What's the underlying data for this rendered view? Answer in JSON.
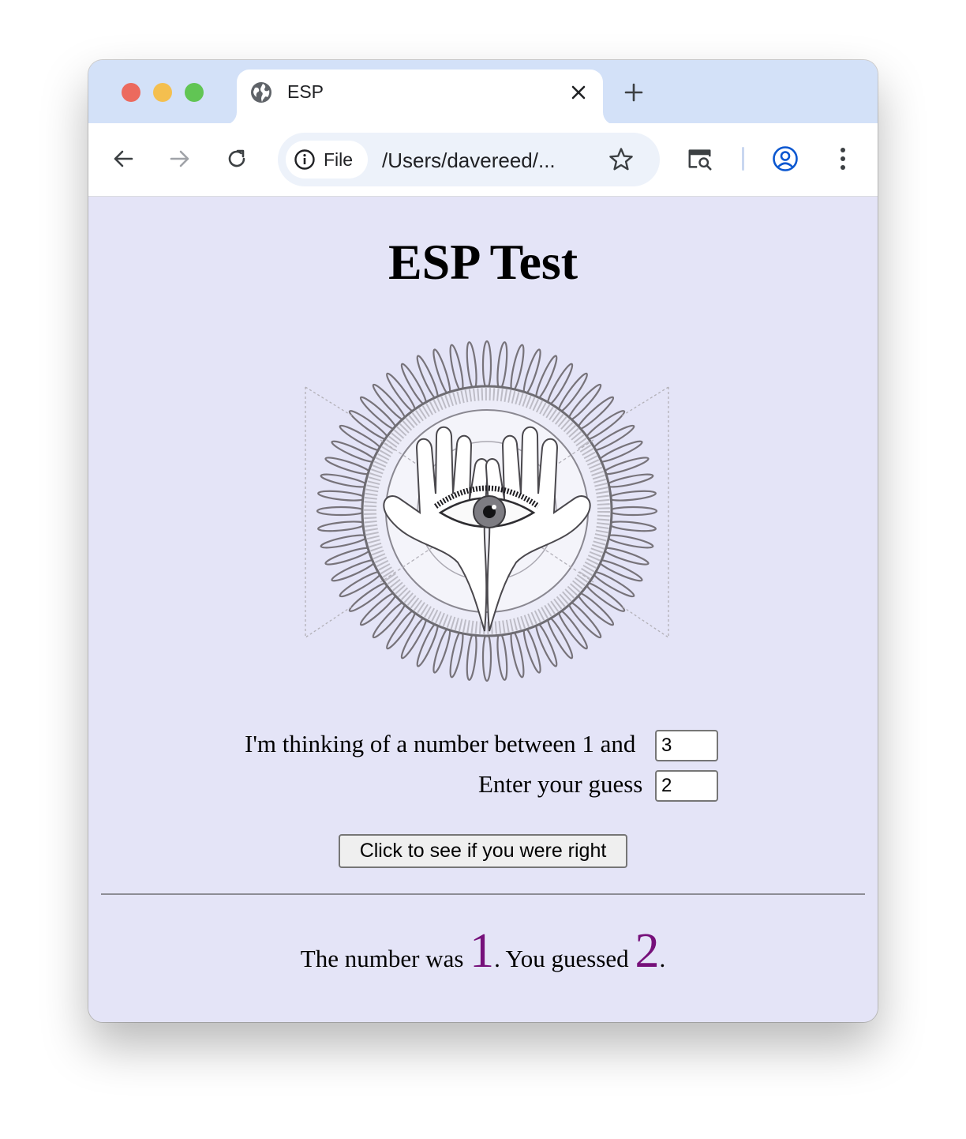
{
  "browser": {
    "tab": {
      "title": "ESP"
    },
    "address": {
      "chip_label": "File",
      "url": "/Users/davereed/..."
    }
  },
  "page": {
    "title": "ESP Test",
    "range_label": "I'm thinking of a number between 1 and",
    "range_value": "3",
    "guess_label": "Enter your guess",
    "guess_value": "2",
    "check_button": "Click to see if you were right",
    "result": {
      "prefix": "The number was",
      "number": "1",
      "middle": ". You guessed",
      "guess": "2",
      "suffix": "."
    }
  },
  "colors": {
    "page_background": "#e4e4f7",
    "tab_strip": "#d3e1f8",
    "result_highlight": "#76107a"
  },
  "icons": [
    "globe-icon",
    "close-icon",
    "plus-icon",
    "back-arrow-icon",
    "forward-arrow-icon",
    "reload-icon",
    "info-icon",
    "star-icon",
    "search-tab-icon",
    "profile-icon",
    "menu-dots-icon"
  ]
}
